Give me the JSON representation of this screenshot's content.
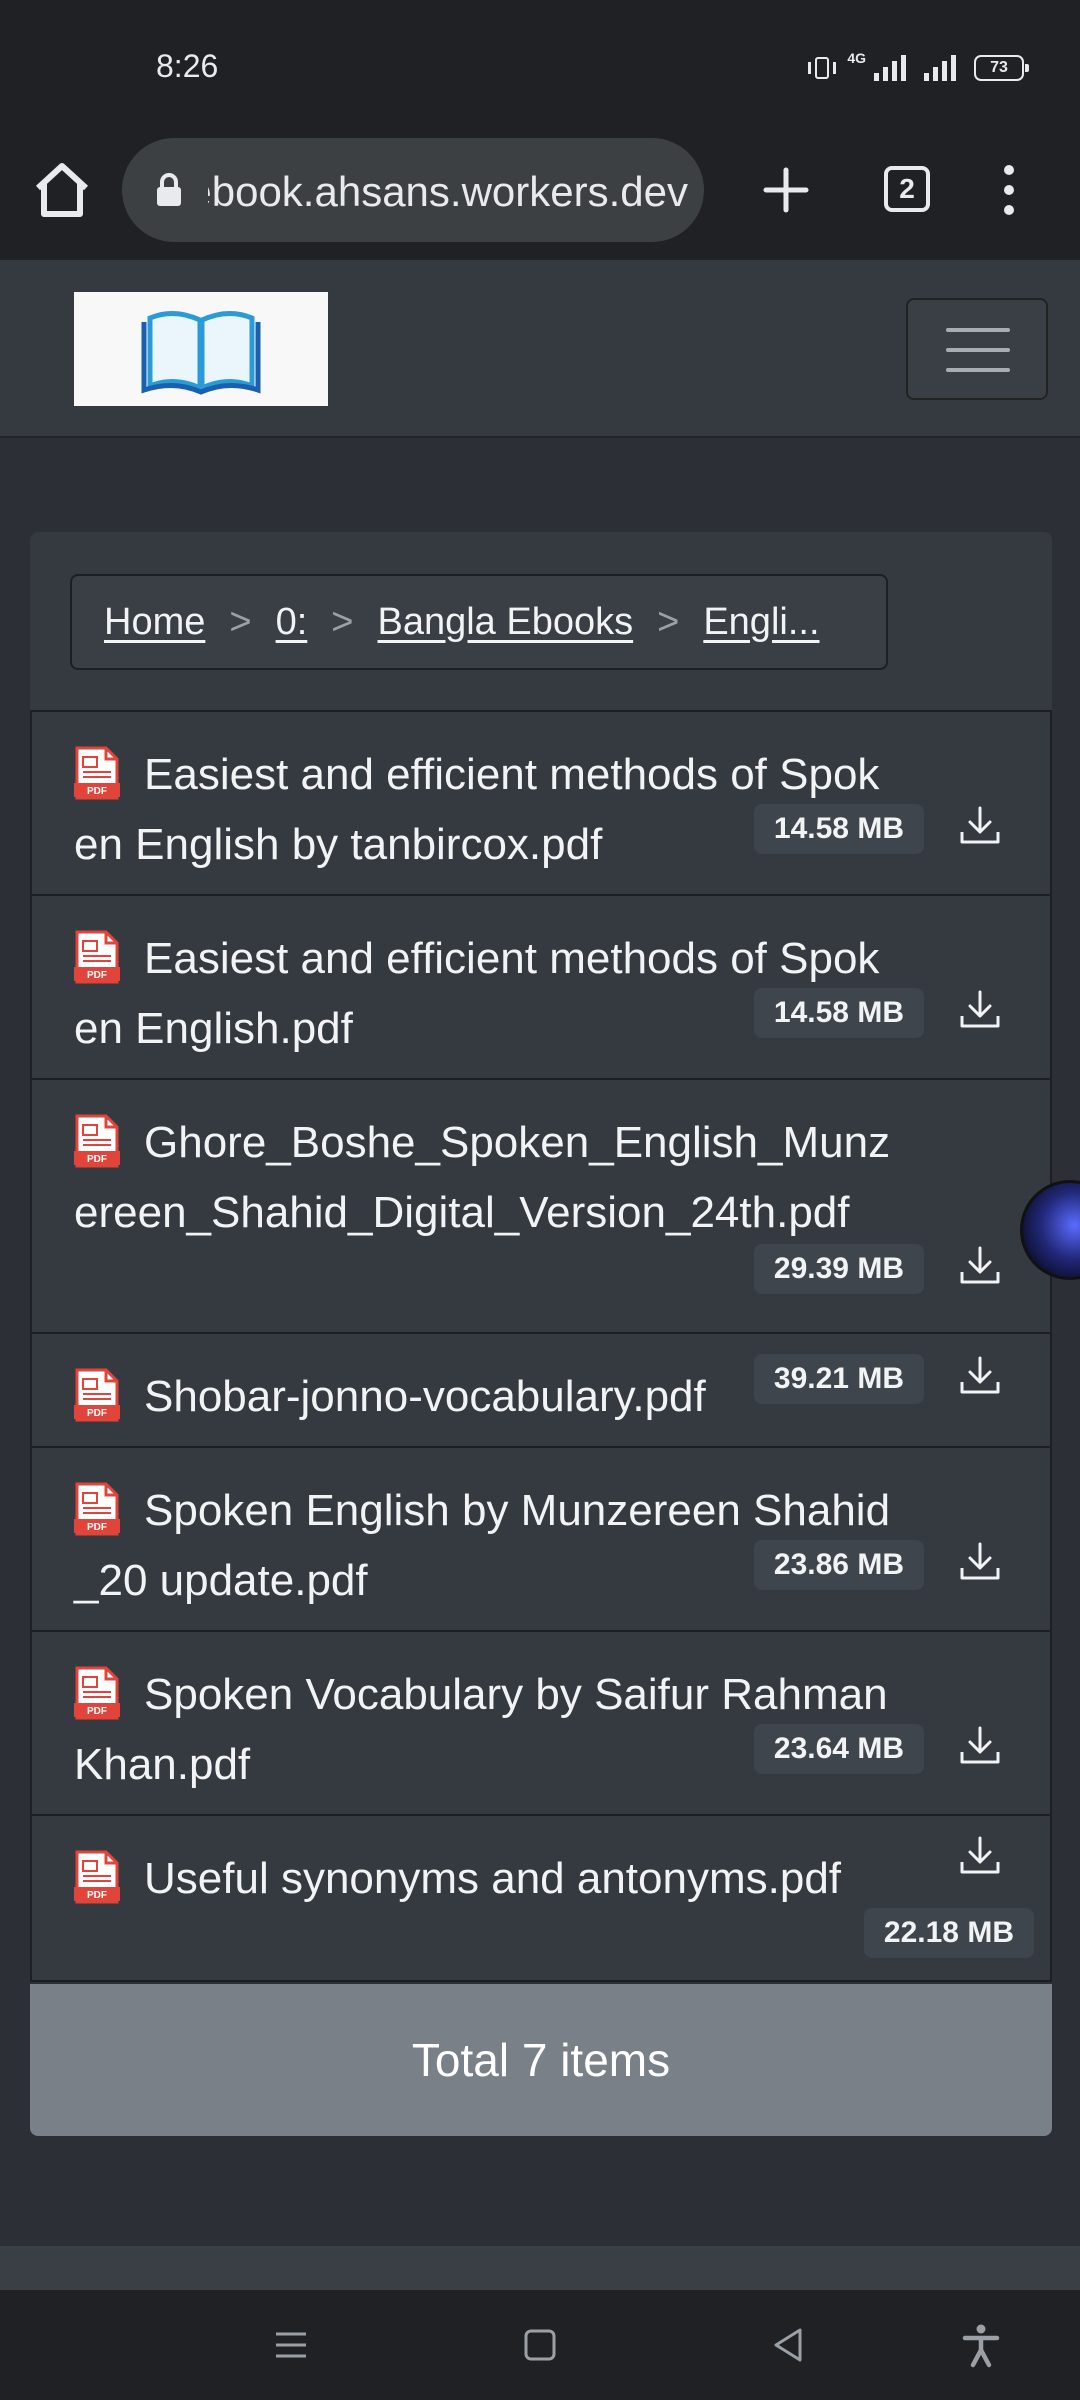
{
  "status_bar": {
    "time": "8:26",
    "network": "4G",
    "battery": "73"
  },
  "browser": {
    "url": "ebook.ahsans.workers.dev",
    "tab_count": "2"
  },
  "breadcrumb": {
    "home": "Home",
    "drive": "0:",
    "folder": "Bangla Ebooks",
    "current": "Engli...",
    "separator": ">"
  },
  "files": [
    {
      "name": "Easiest and efficient methods of Spoken English by tanbircox.pdf",
      "size": "14.58 MB"
    },
    {
      "name": "Easiest and efficient methods of Spoken English.pdf",
      "size": "14.58 MB"
    },
    {
      "name": "Ghore_Boshe_Spoken_English_Munzereen_Shahid_Digital_Version_24th.pdf",
      "size": "29.39 MB"
    },
    {
      "name": "Shobar-jonno-vocabulary.pdf",
      "size": "39.21 MB"
    },
    {
      "name": "Spoken English by Munzereen Shahid_20 update.pdf",
      "size": "23.86 MB"
    },
    {
      "name": "Spoken Vocabulary by Saifur Rahman Khan.pdf",
      "size": "23.64 MB"
    },
    {
      "name": "Useful synonyms and antonyms.pdf",
      "size": "22.18 MB"
    }
  ],
  "footer": {
    "total": "Total 7 items"
  },
  "icons": {
    "home": "home-icon",
    "lock": "lock-icon",
    "new_tab": "plus-icon",
    "menu": "more-vert-icon",
    "logo": "open-book-icon",
    "file": "pdf-file-icon",
    "download": "download-icon"
  },
  "colors": {
    "page_bg": "#2c2f36",
    "card_bg": "#343a40",
    "footer_bg": "#7a8087",
    "pdf_red": "#e0443a"
  }
}
